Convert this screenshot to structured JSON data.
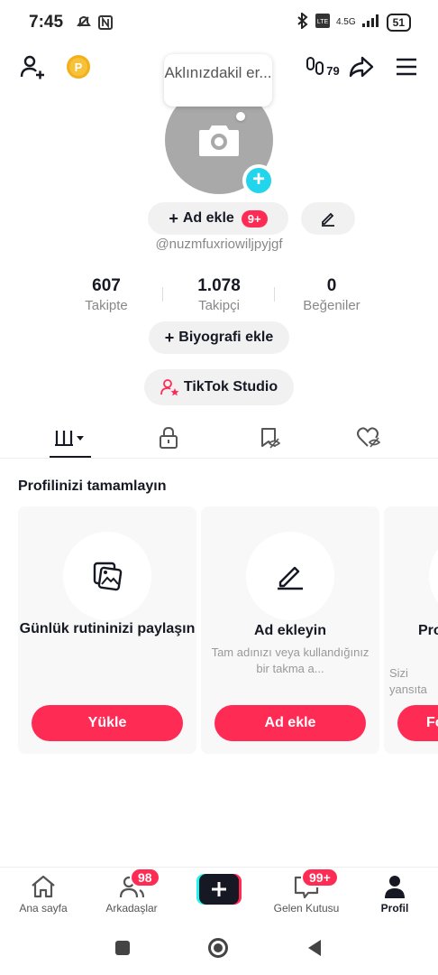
{
  "status_bar": {
    "time": "7:45",
    "left_icons": "⚡ N",
    "network": "4.5G",
    "battery": "51"
  },
  "top_bar": {
    "coin_letter": "P",
    "notification_count": "79"
  },
  "bubble": {
    "text": "Aklınızdakil er..."
  },
  "profile": {
    "add_name_label": "Ad ekle",
    "add_name_badge": "9+",
    "username": "@nuzmfuxriowiljpyjgf",
    "bio_button": "Biyografi ekle",
    "studio_button": "TikTok Studio"
  },
  "stats": [
    {
      "value": "607",
      "label": "Takipte"
    },
    {
      "value": "1.078",
      "label": "Takipçi"
    },
    {
      "value": "0",
      "label": "Beğeniler"
    }
  ],
  "section_title": "Profilinizi tamamlayın",
  "cards": [
    {
      "title": "Günlük rutininizi paylaşın",
      "desc": "",
      "button": "Yükle"
    },
    {
      "title": "Ad ekleyin",
      "desc": "Tam adınızı veya kullandığınız bir takma a...",
      "button": "Ad ekle"
    },
    {
      "title": "Pro",
      "desc": "Sizi yansıta",
      "button": "Fo"
    }
  ],
  "bottom_nav": [
    {
      "label": "Ana sayfa"
    },
    {
      "label": "Arkadaşlar",
      "badge": "98"
    },
    {
      "label": "Gelen Kutusu",
      "badge": "99+"
    },
    {
      "label": "Profil"
    }
  ],
  "colors": {
    "accent": "#fe2c55",
    "cyan": "#20d5ec"
  }
}
